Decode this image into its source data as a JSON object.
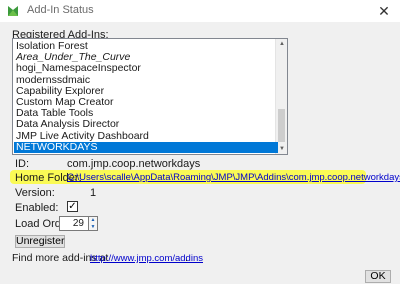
{
  "window": {
    "title": "Add-In Status",
    "close_glyph": "✕",
    "icon": "jmp-app-icon"
  },
  "registered_label": "Registered Add-Ins:",
  "addins": [
    {
      "label": "Isolation Forest",
      "italic": false,
      "selected": false
    },
    {
      "label": "Area_Under_The_Curve",
      "italic": true,
      "selected": false
    },
    {
      "label": "hogi_NamespaceInspector",
      "italic": false,
      "selected": false
    },
    {
      "label": "modernssdmaic",
      "italic": false,
      "selected": false
    },
    {
      "label": "Capability Explorer",
      "italic": false,
      "selected": false
    },
    {
      "label": "Custom Map Creator",
      "italic": false,
      "selected": false
    },
    {
      "label": "Data Table Tools",
      "italic": false,
      "selected": false
    },
    {
      "label": "Data Analysis Director",
      "italic": false,
      "selected": false
    },
    {
      "label": "JMP Live Activity Dashboard",
      "italic": false,
      "selected": false
    },
    {
      "label": "NETWORKDAYS",
      "italic": false,
      "selected": true
    }
  ],
  "details": {
    "id_label": "ID:",
    "id_value": "com.jmp.coop.networkdays",
    "home_label": "Home Folder:",
    "home_value": "C:\\Users\\scalle\\AppData\\Roaming\\JMP\\JMP\\Addins\\com.jmp.coop.networkdays\\",
    "version_label": "Version:",
    "version_value": "1",
    "enabled_label": "Enabled:",
    "enabled_checked": true,
    "enabled_glyph": "✓",
    "load_order_label": "Load Order:",
    "load_order_value": "29"
  },
  "unregister_label": "Unregister",
  "more_text": "Find more add-ins at",
  "more_link": "http://www.jmp.com/addins",
  "more_dot": ".",
  "ok_label": "OK",
  "colors": {
    "selection": "#0078d7",
    "highlight": "#fbfb3a",
    "link": "#0000cc"
  }
}
